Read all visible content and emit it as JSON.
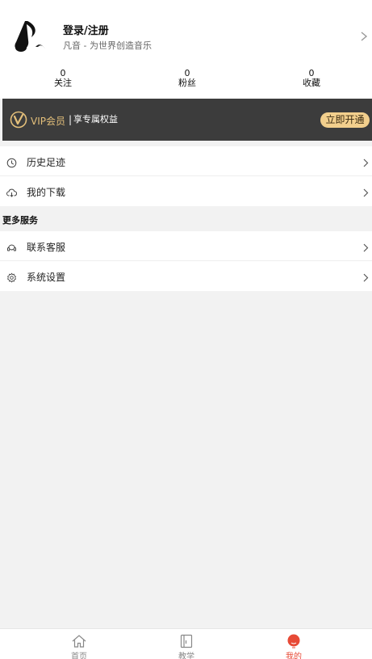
{
  "profile": {
    "name": "登录/注册",
    "slogan": "凡音 - 为世界创造音乐"
  },
  "stats": [
    {
      "value": "0",
      "label": "关注"
    },
    {
      "value": "0",
      "label": "粉丝"
    },
    {
      "value": "0",
      "label": "收藏"
    }
  ],
  "vip": {
    "title": "VIP会员",
    "separator": "|",
    "description": "享专属权益",
    "button": "立即开通",
    "accent_color": "#e3bf7a",
    "button_color": "#f2cf8d"
  },
  "menu_top": [
    {
      "label": "历史足迹",
      "icon": "clock-icon"
    },
    {
      "label": "我的下载",
      "icon": "cloud-download-icon"
    }
  ],
  "more_services": {
    "title": "更多服务",
    "items": [
      {
        "label": "联系客服",
        "icon": "headset-icon"
      },
      {
        "label": "系统设置",
        "icon": "gear-icon"
      }
    ]
  },
  "tabbar": {
    "active_color": "#e74a36",
    "tabs": [
      {
        "label": "首页",
        "icon": "home-icon"
      },
      {
        "label": "教学",
        "icon": "book-icon"
      },
      {
        "label": "我的",
        "icon": "user-icon"
      }
    ]
  }
}
